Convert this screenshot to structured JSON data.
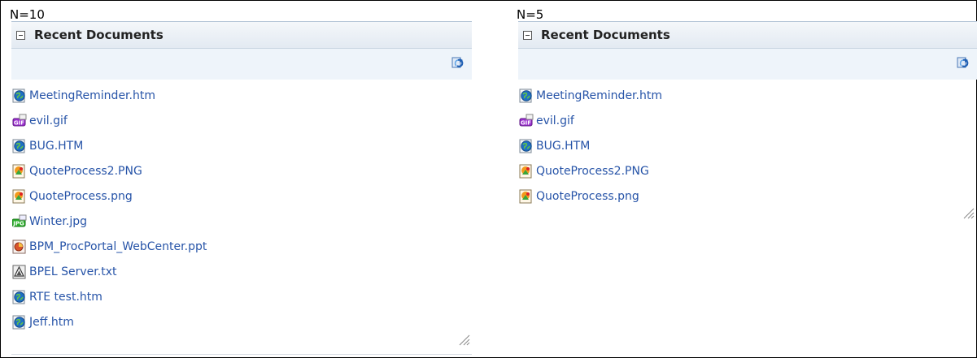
{
  "panels": [
    {
      "n_label": "N=10",
      "title": "Recent Documents",
      "items": [
        {
          "name": "MeetingReminder.htm",
          "icon": "html-globe-icon"
        },
        {
          "name": "evil.gif",
          "icon": "gif-image-icon"
        },
        {
          "name": "BUG.HTM",
          "icon": "html-globe-icon"
        },
        {
          "name": "QuoteProcess2.PNG",
          "icon": "png-image-icon"
        },
        {
          "name": "QuoteProcess.png",
          "icon": "png-image-icon"
        },
        {
          "name": "Winter.jpg",
          "icon": "jpg-image-icon"
        },
        {
          "name": "BPM_ProcPortal_WebCenter.ppt",
          "icon": "ppt-document-icon"
        },
        {
          "name": "BPEL Server.txt",
          "icon": "txt-document-icon"
        },
        {
          "name": "RTE test.htm",
          "icon": "html-globe-icon"
        },
        {
          "name": "Jeff.htm",
          "icon": "html-globe-icon"
        }
      ]
    },
    {
      "n_label": "N=5",
      "title": "Recent Documents",
      "items": [
        {
          "name": "MeetingReminder.htm",
          "icon": "html-globe-icon"
        },
        {
          "name": "evil.gif",
          "icon": "gif-image-icon"
        },
        {
          "name": "BUG.HTM",
          "icon": "html-globe-icon"
        },
        {
          "name": "QuoteProcess2.PNG",
          "icon": "png-image-icon"
        },
        {
          "name": "QuoteProcess.png",
          "icon": "png-image-icon"
        }
      ]
    }
  ],
  "colors": {
    "link": "#2754a8",
    "toolbar_bg": "#eef4fa",
    "header_bg": "#e3eaf2"
  }
}
